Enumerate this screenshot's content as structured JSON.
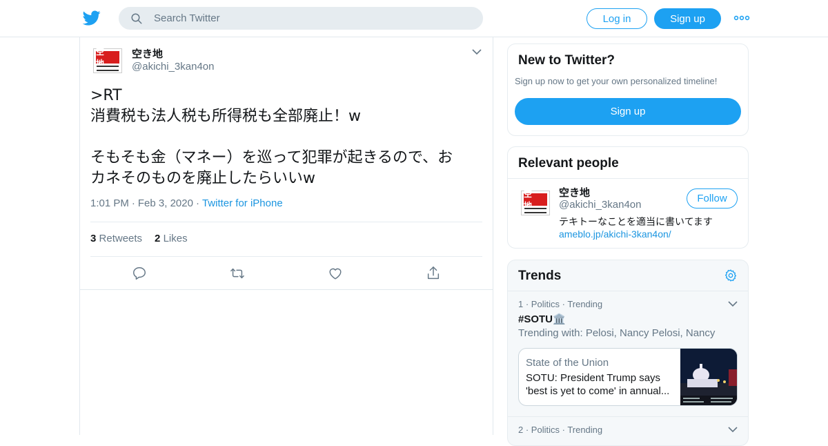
{
  "header": {
    "search_placeholder": "Search Twitter",
    "login_label": "Log in",
    "signup_label": "Sign up",
    "brand_color": "#1da1f2"
  },
  "tweet": {
    "author_name": "空き地",
    "author_handle": "@akichi_3kan4on",
    "avatar_text": "空 地",
    "text_lines": [
      ">RT",
      "消費税も法人税も所得税も全部廃止！w",
      "",
      "そもそも金（マネー）を巡って犯罪が起きるので、お",
      "カネそのものを廃止したらいいw"
    ],
    "time": "1:01 PM",
    "date": "Feb 3, 2020",
    "source": "Twitter for iPhone",
    "retweets_count": "3",
    "retweets_label": "Retweets",
    "likes_count": "2",
    "likes_label": "Likes"
  },
  "new_to_twitter": {
    "title": "New to Twitter?",
    "subtitle": "Sign up now to get your own personalized timeline!",
    "signup_label": "Sign up"
  },
  "relevant_people": {
    "title": "Relevant people",
    "name": "空き地",
    "handle": "@akichi_3kan4on",
    "follow_label": "Follow",
    "bio": "テキトーなことを適当に書いてます",
    "link": "ameblo.jp/akichi-3kan4on/"
  },
  "trends": {
    "title": "Trends",
    "items": [
      {
        "rank": "1",
        "category": "Politics",
        "status": "Trending",
        "tag": "#SOTU🏛️",
        "trending_with": "Trending with: Pelosi, Nancy Pelosi, Nancy",
        "news_source": "State of the Union",
        "news_headline_1": "SOTU: President Trump says",
        "news_headline_2": "'best is yet to come' in annual..."
      },
      {
        "rank": "2",
        "category": "Politics",
        "status": "Trending"
      }
    ]
  }
}
